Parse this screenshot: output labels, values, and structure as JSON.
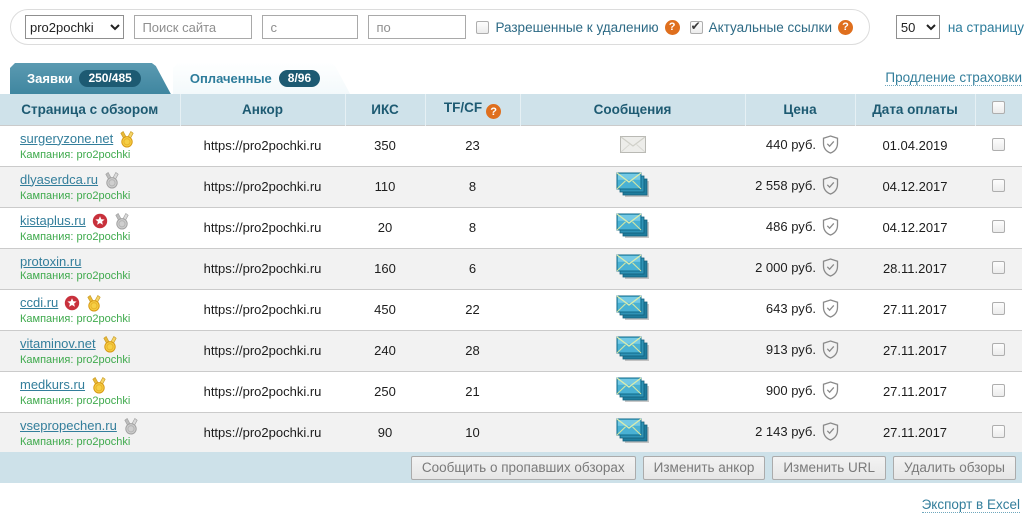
{
  "toolbar": {
    "campaign_select": {
      "value": "pro2pochki"
    },
    "site_search": {
      "placeholder": "Поиск сайта"
    },
    "date_from": {
      "placeholder": "с"
    },
    "date_to": {
      "placeholder": "по"
    },
    "checkbox_deletable": {
      "label": "Разрешенные к удалению",
      "checked": false
    },
    "checkbox_actual": {
      "label": "Актуальные ссылки",
      "checked": true
    },
    "per_page": {
      "value": "50",
      "label": "на страницу"
    }
  },
  "tabs": [
    {
      "label": "Заявки",
      "badge": "250/485",
      "active": false
    },
    {
      "label": "Оплаченные",
      "badge": "8/96",
      "active": true
    }
  ],
  "insurance_link": "Продление страховки",
  "table": {
    "headers": [
      "Страница с обзором",
      "Анкор",
      "ИКС",
      "TF/CF",
      "Сообщения",
      "Цена",
      "Дата оплаты"
    ],
    "rows": [
      {
        "site": "surgeryzone.net",
        "star": false,
        "medal": "gold",
        "campaign": "Кампания: pro2pochki",
        "anchor": "https://pro2pochki.ru",
        "iks": "350",
        "tfcf": "23",
        "messages": "single",
        "price": "440 руб.",
        "date": "01.04.2019"
      },
      {
        "site": "dlyaserdca.ru",
        "star": false,
        "medal": "silver",
        "campaign": "Кампания: pro2pochki",
        "anchor": "https://pro2pochki.ru",
        "iks": "110",
        "tfcf": "8",
        "messages": "stack",
        "price": "2 558 руб.",
        "date": "04.12.2017"
      },
      {
        "site": "kistaplus.ru",
        "star": true,
        "medal": "silver",
        "campaign": "Кампания: pro2pochki",
        "anchor": "https://pro2pochki.ru",
        "iks": "20",
        "tfcf": "8",
        "messages": "stack",
        "price": "486 руб.",
        "date": "04.12.2017"
      },
      {
        "site": "protoxin.ru",
        "star": false,
        "medal": null,
        "campaign": "Кампания: pro2pochki",
        "anchor": "https://pro2pochki.ru",
        "iks": "160",
        "tfcf": "6",
        "messages": "stack",
        "price": "2 000 руб.",
        "date": "28.11.2017"
      },
      {
        "site": "ccdi.ru",
        "star": true,
        "medal": "gold",
        "campaign": "Кампания: pro2pochki",
        "anchor": "https://pro2pochki.ru",
        "iks": "450",
        "tfcf": "22",
        "messages": "stack",
        "price": "643 руб.",
        "date": "27.11.2017"
      },
      {
        "site": "vitaminov.net",
        "star": false,
        "medal": "gold",
        "campaign": "Кампания: pro2pochki",
        "anchor": "https://pro2pochki.ru",
        "iks": "240",
        "tfcf": "28",
        "messages": "stack",
        "price": "913 руб.",
        "date": "27.11.2017"
      },
      {
        "site": "medkurs.ru",
        "star": false,
        "medal": "gold",
        "campaign": "Кампания: pro2pochki",
        "anchor": "https://pro2pochki.ru",
        "iks": "250",
        "tfcf": "21",
        "messages": "stack",
        "price": "900 руб.",
        "date": "27.11.2017"
      },
      {
        "site": "vsepropechen.ru",
        "star": false,
        "medal": "silver",
        "campaign": "Кампания: pro2pochki",
        "anchor": "https://pro2pochki.ru",
        "iks": "90",
        "tfcf": "10",
        "messages": "stack",
        "price": "2 143 руб.",
        "date": "27.11.2017"
      }
    ]
  },
  "footer": {
    "buttons": [
      "Сообщить о пропавших обзорах",
      "Изменить анкор",
      "Изменить URL",
      "Удалить обзоры"
    ]
  },
  "export_link": "Экспорт в Excel",
  "colors": {
    "accent_teal": "#337e9b",
    "tab_teal": "#4a8ca4",
    "badge_teal": "#1d5a72",
    "header_bg": "#cfe2ea",
    "footer_bg": "#cde1e9",
    "help_orange": "#df6f1e",
    "campaign_green": "#3faa4d",
    "star_red": "#c8313c",
    "medal_gold": "#f2c437",
    "row_alt": "#f2f2f2"
  }
}
